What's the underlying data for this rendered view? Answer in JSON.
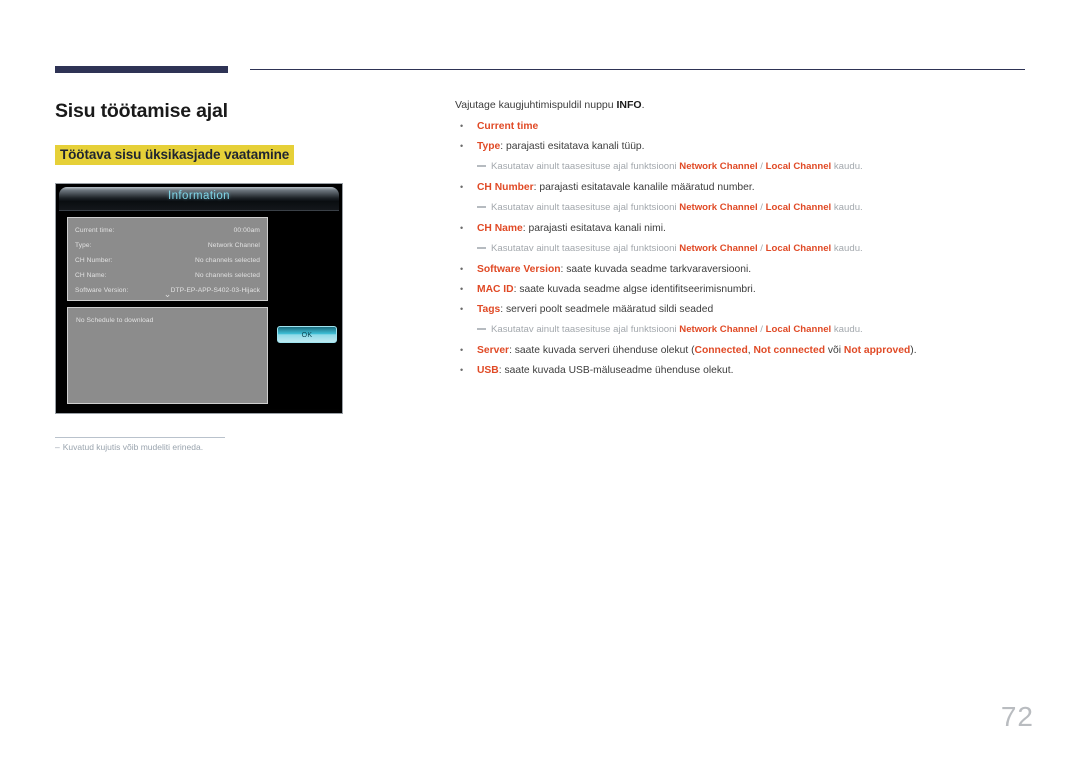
{
  "document": {
    "page_number": "72",
    "heading": "Sisu töötamise ajal",
    "subheading": "Töötava sisu üksikasjade vaatamine"
  },
  "figure": {
    "caption_dash": "–",
    "caption": "Kuvatud kujutis võib mudeliti erineda.",
    "tv": {
      "title": "Information",
      "rows": [
        {
          "key": "Current time:",
          "value": "00:00am"
        },
        {
          "key": "Type:",
          "value": "Network Channel"
        },
        {
          "key": "CH Number:",
          "value": "No channels selected"
        },
        {
          "key": "CH Name:",
          "value": "No channels selected"
        },
        {
          "key": "Software Version:",
          "value": "DTP-EP-APP-S402-03-Hijack"
        }
      ],
      "chevron": "⌄",
      "schedule_text": "No Schedule to download",
      "ok_label": "OK"
    }
  },
  "content": {
    "intro_before": "Vajutage kaugjuhtimispuldil nuppu ",
    "intro_bold": "INFO",
    "intro_after": ".",
    "note_prefix": "Kasutatav ainult taasesituse ajal funktsiooni ",
    "note_a": "Network Channel",
    "note_sep": " / ",
    "note_b": "Local Channel",
    "note_suffix": " kaudu.",
    "items": [
      {
        "term": "Current time",
        "desc": ""
      },
      {
        "term": "Type",
        "desc": ": parajasti esitatava kanali tüüp."
      },
      {
        "term": "CH Number",
        "desc": ": parajasti esitatavale kanalile määratud number."
      },
      {
        "term": "CH Name",
        "desc": ": parajasti esitatava kanali nimi."
      },
      {
        "term": "Software Version",
        "desc": ": saate kuvada seadme tarkvaraversiooni."
      },
      {
        "term": "MAC ID",
        "desc": ": saate kuvada seadme algse identifitseerimisnumbri."
      },
      {
        "term": "Tags",
        "desc": ": serveri poolt seadmele määratud sildi seaded"
      },
      {
        "term": "USB",
        "desc": ": saate kuvada USB-mäluseadme ühenduse olekut."
      }
    ],
    "server_item": {
      "term": "Server",
      "part1": ": saate kuvada serveri ühenduse olekut (",
      "state1": "Connected",
      "part2": ", ",
      "state2": "Not connected",
      "part3": " või ",
      "state3": "Not approved",
      "part4": ")."
    }
  },
  "colors": {
    "accent_orange": "#e04a26",
    "navy": "#2e3355",
    "highlight_yellow": "#e6d038",
    "muted_gray": "#a3a8ad",
    "tv_cyan": "#7fd4e6"
  }
}
